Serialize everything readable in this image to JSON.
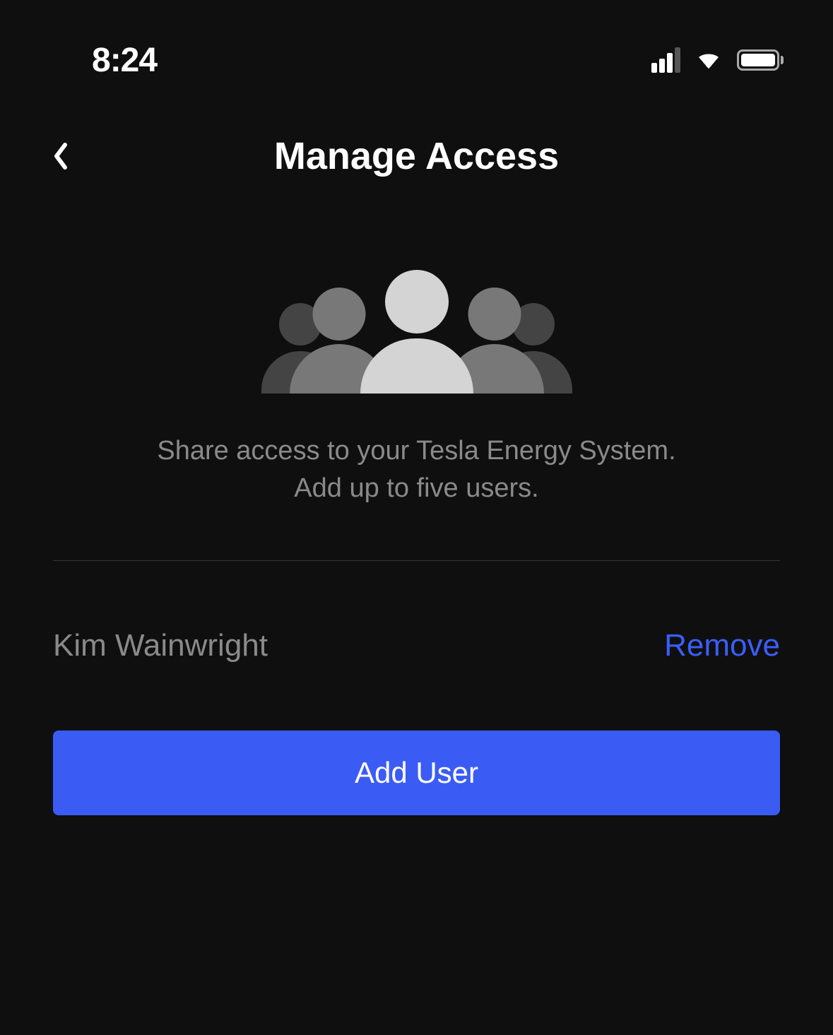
{
  "statusBar": {
    "time": "8:24"
  },
  "header": {
    "title": "Manage Access"
  },
  "hero": {
    "descriptionLine1": "Share access to your Tesla Energy System.",
    "descriptionLine2": "Add up to five users."
  },
  "users": [
    {
      "name": "Kim Wainwright",
      "removeLabel": "Remove"
    }
  ],
  "actions": {
    "addUserLabel": "Add User"
  },
  "colors": {
    "accent": "#3a5cf5",
    "link": "#3b5efb",
    "background": "#0f0f0f",
    "textMuted": "#8a8a8a"
  }
}
